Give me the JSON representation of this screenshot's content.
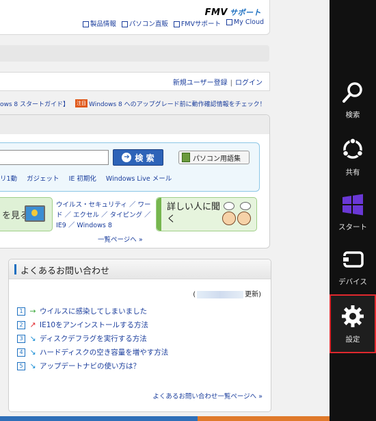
{
  "header": {
    "logo_main": "FMV",
    "logo_sub": "サポート",
    "links": [
      "製品情報",
      "パソコン直販",
      "FMVサポート",
      "My Cloud"
    ]
  },
  "account": {
    "register": "新規ユーザー登録",
    "separator": "|",
    "login": "ログイン"
  },
  "news": {
    "item1": "ows 8 スタートガイド】",
    "tag": "注目",
    "item2": "Windows 8 へのアップグレード前に動作確認情報をチェック！"
  },
  "search": {
    "button_label": "検 索",
    "glossary_label": "パソコン用語集",
    "keywords": [
      "リ1動",
      "ガジェット",
      "IE 初期化",
      "Windows Live メール"
    ]
  },
  "banners": {
    "left_text": "を見る",
    "right_text": "詳しい人に聞く",
    "mid_links": "ウイルス・セキュリティ ／ ワード ／ エクセル ／ タイピング ／ IE9 ／ Windows 8",
    "list_more": "一覧ページへ »"
  },
  "faq": {
    "title": "よくあるお問い合わせ",
    "updated_prefix": "(",
    "updated_suffix": "更新)",
    "items": [
      {
        "num": "1",
        "arrow": "→",
        "arrow_color": "#3aa83a",
        "text": "ウイルスに感染してしまいました"
      },
      {
        "num": "2",
        "arrow": "↗",
        "arrow_color": "#e0282e",
        "text": "IE10をアンインストールする方法"
      },
      {
        "num": "3",
        "arrow": "↘",
        "arrow_color": "#1b8fd6",
        "text": "ディスクデフラグを実行する方法"
      },
      {
        "num": "4",
        "arrow": "↘",
        "arrow_color": "#1b8fd6",
        "text": "ハードディスクの空き容量を増やす方法"
      },
      {
        "num": "5",
        "arrow": "↘",
        "arrow_color": "#1b8fd6",
        "text": "アップデートナビの使い方は？"
      }
    ],
    "more": "よくあるお問い合わせ一覧ページへ »"
  },
  "charms": {
    "items": [
      {
        "label": "検索",
        "icon": "search-icon"
      },
      {
        "label": "共有",
        "icon": "share-icon"
      },
      {
        "label": "スタート",
        "icon": "windows-start-icon"
      },
      {
        "label": "デバイス",
        "icon": "devices-icon"
      },
      {
        "label": "設定",
        "icon": "settings-gear-icon"
      }
    ],
    "selected": "設定",
    "selected_color": "#e0282e"
  }
}
